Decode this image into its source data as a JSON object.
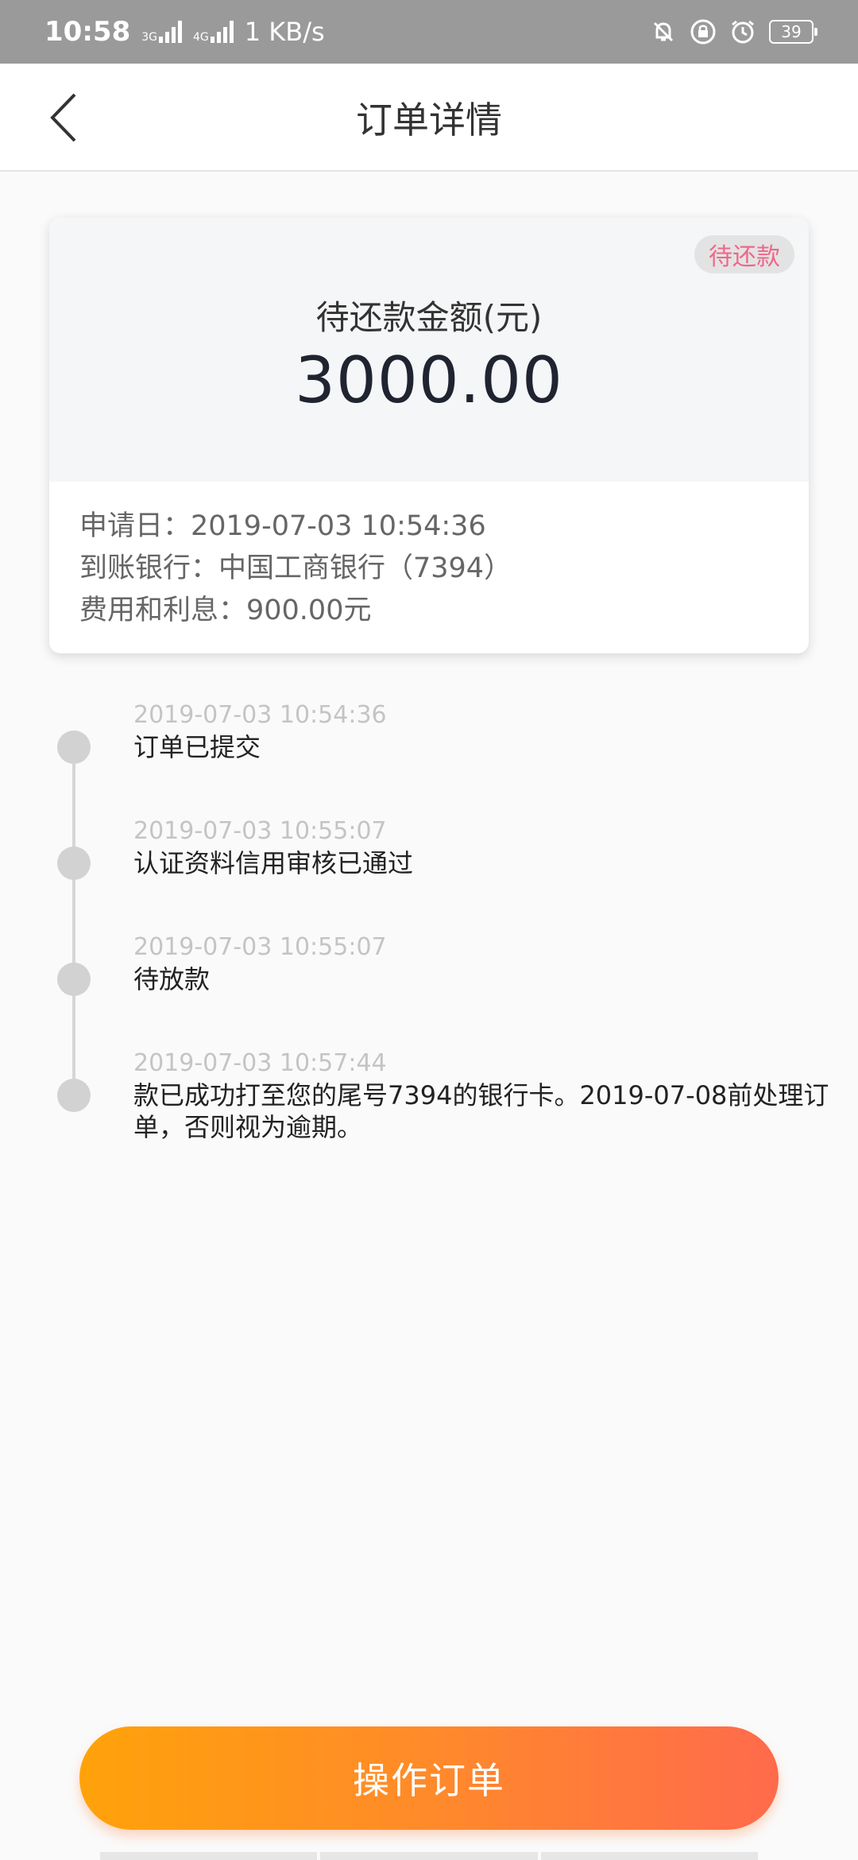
{
  "status_bar": {
    "time": "10:58",
    "network_1": "3G",
    "network_2": "4G",
    "speed": "1 KB/s",
    "battery": "39"
  },
  "header": {
    "title": "订单详情"
  },
  "summary": {
    "badge": "待还款",
    "amount_label": "待还款金额(元)",
    "amount": "3000.00",
    "apply_date": "申请日：2019-07-03 10:54:36",
    "bank": "到账银行：中国工商银行（7394）",
    "fee": "费用和利息：900.00元"
  },
  "timeline": [
    {
      "time": "2019-07-03 10:54:36",
      "text": "订单已提交"
    },
    {
      "time": "2019-07-03 10:55:07",
      "text": "认证资料信用审核已通过"
    },
    {
      "time": "2019-07-03 10:55:07",
      "text": "待放款"
    },
    {
      "time": "2019-07-03 10:57:44",
      "text": "款已成功打至您的尾号7394的银行卡。2019-07-08前处理订单，否则视为逾期。"
    }
  ],
  "actions": {
    "primary_label": "操作订单"
  },
  "icons": {
    "back": "chevron-left-icon",
    "mute": "bell-off-icon",
    "lock": "lock-icon",
    "alarm": "alarm-icon"
  },
  "colors": {
    "badge_text": "#f0668a",
    "button_start": "#ffa20a",
    "button_end": "#ff6a4c"
  }
}
